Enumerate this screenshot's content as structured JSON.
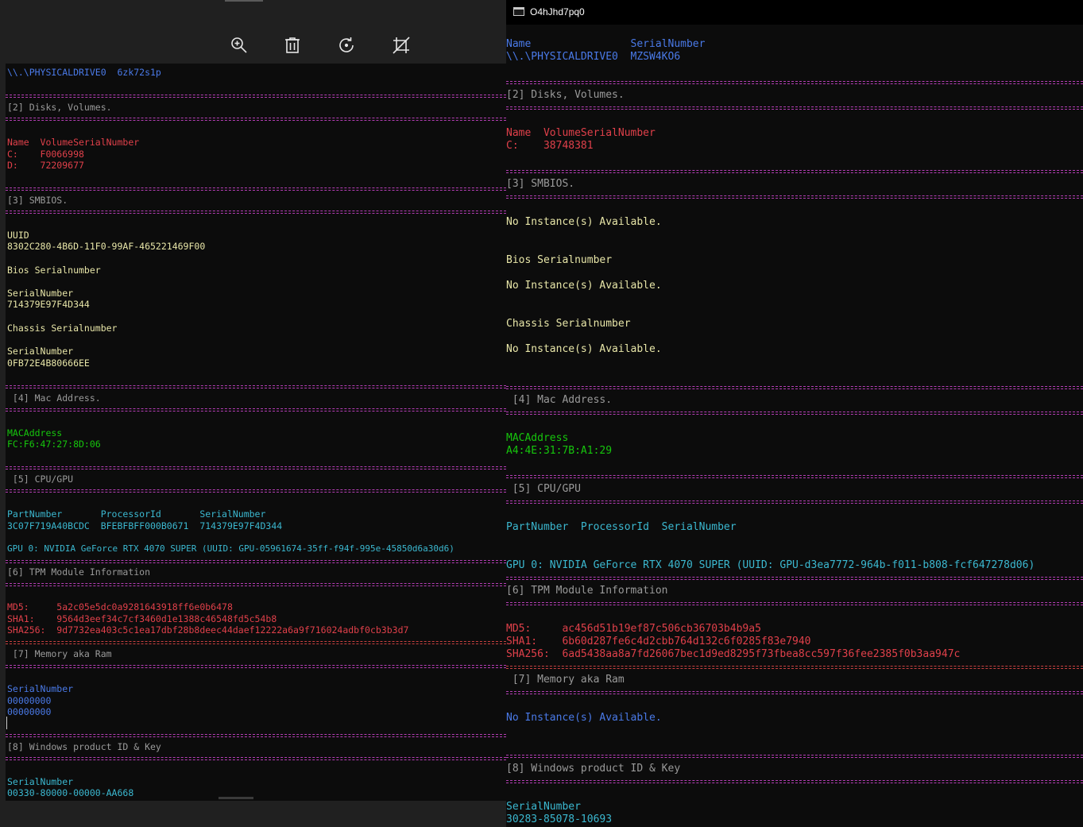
{
  "viewer": {
    "toolbar": {
      "zoom": "zoom-in-icon",
      "delete": "delete-icon",
      "rotate": "rotate-icon",
      "crop": "crop-icon"
    },
    "image": {
      "drive_line": "\\\\.\\PHYSICALDRIVE0  6zk72s1p",
      "disks_header": "[2] Disks, Volumes.",
      "vol_header": "Name  VolumeSerialNumber",
      "vol_c": "C:    F0066998",
      "vol_d": "D:    72209677",
      "smbios_header": "[3] SMBIOS.",
      "uuid_label": "UUID",
      "uuid_value": "8302C280-4B6D-11F0-99AF-465221469F00",
      "bios_label": "Bios Serialnumber",
      "bios_sn_label": "SerialNumber",
      "bios_sn_value": "714379E97F4D344",
      "chassis_label": "Chassis Serialnumber",
      "chassis_sn_label": "SerialNumber",
      "chassis_sn_value": "0FB72E4B80666EE",
      "mac_header": " [4] Mac Address.",
      "mac_label": "MACAddress",
      "mac_value": "FC:F6:47:27:8D:06",
      "cpu_header": " [5] CPU/GPU",
      "cpu_cols": "PartNumber       ProcessorId       SerialNumber",
      "cpu_values": "3C07F719A40BCDC  BFEBFBFF000B0671  714379E97F4D344",
      "gpu_line": "GPU 0: NVIDIA GeForce RTX 4070 SUPER (UUID: GPU-05961674-35ff-f94f-995e-45850d6a30d6)",
      "tpm_header": "[6] TPM Module Information",
      "md5": "MD5:     5a2c05e5dc0a9281643918ff6e0b6478",
      "sha1": "SHA1:    9564d3eef34c7cf3460d1e1388c46548fd5c54b8",
      "sha256": "SHA256:  9d7732ea403c5c1ea17dbf28b8deec44daef12222a6a9f716024adbf0cb3b3d7",
      "mem_header": " [7] Memory aka Ram",
      "mem_label": "SerialNumber",
      "mem_value_1": "00000000",
      "mem_value_2": "00000000",
      "win_header": "[8] Windows product ID & Key",
      "win_label": "SerialNumber",
      "win_value": "00330-80000-00000-AA668"
    }
  },
  "console": {
    "title": "O4hJhd7pq0",
    "drive_cols": "Name                SerialNumber",
    "drive_values": "\\\\.\\PHYSICALDRIVE0  MZSW4KO6",
    "disks_header": "[2] Disks, Volumes.",
    "vol_header": "Name  VolumeSerialNumber",
    "vol_c": "C:    38748381",
    "smbios_header": "[3] SMBIOS.",
    "no_instance_1": "No Instance(s) Available.",
    "bios_label": "Bios Serialnumber",
    "no_instance_2": "No Instance(s) Available.",
    "chassis_label": "Chassis Serialnumber",
    "no_instance_3": "No Instance(s) Available.",
    "mac_header": " [4] Mac Address.",
    "mac_label": "MACAddress",
    "mac_value": "A4:4E:31:7B:A1:29",
    "cpu_header": " [5] CPU/GPU",
    "cpu_cols": "PartNumber  ProcessorId  SerialNumber",
    "gpu_line": "GPU 0: NVIDIA GeForce RTX 4070 SUPER (UUID: GPU-d3ea7772-964b-f011-b808-fcf647278d06)",
    "tpm_header": "[6] TPM Module Information",
    "md5": "MD5:     ac456d51b19ef87c506cb36703b4b9a5",
    "sha1": "SHA1:    6b60d287fe6c4d2cbb764d132c6f0285f83e7940",
    "sha256": "SHA256:  6ad5438aa8a7fd26067bec1d9ed8295f73fbea8cc597f36fee2385f0b3aa947c",
    "mem_header": " [7] Memory aka Ram",
    "mem_none": "No Instance(s) Available.",
    "win_header": "[8] Windows product ID & Key",
    "win_label": "SerialNumber",
    "win_value": "30283-85078-10693"
  },
  "colors": {
    "separator": "#b63eb6",
    "blue": "#4a7ae8",
    "red": "#e0404a",
    "yellow": "#e8e6a8",
    "green": "#16c60c",
    "cyan": "#3bb8d0"
  }
}
